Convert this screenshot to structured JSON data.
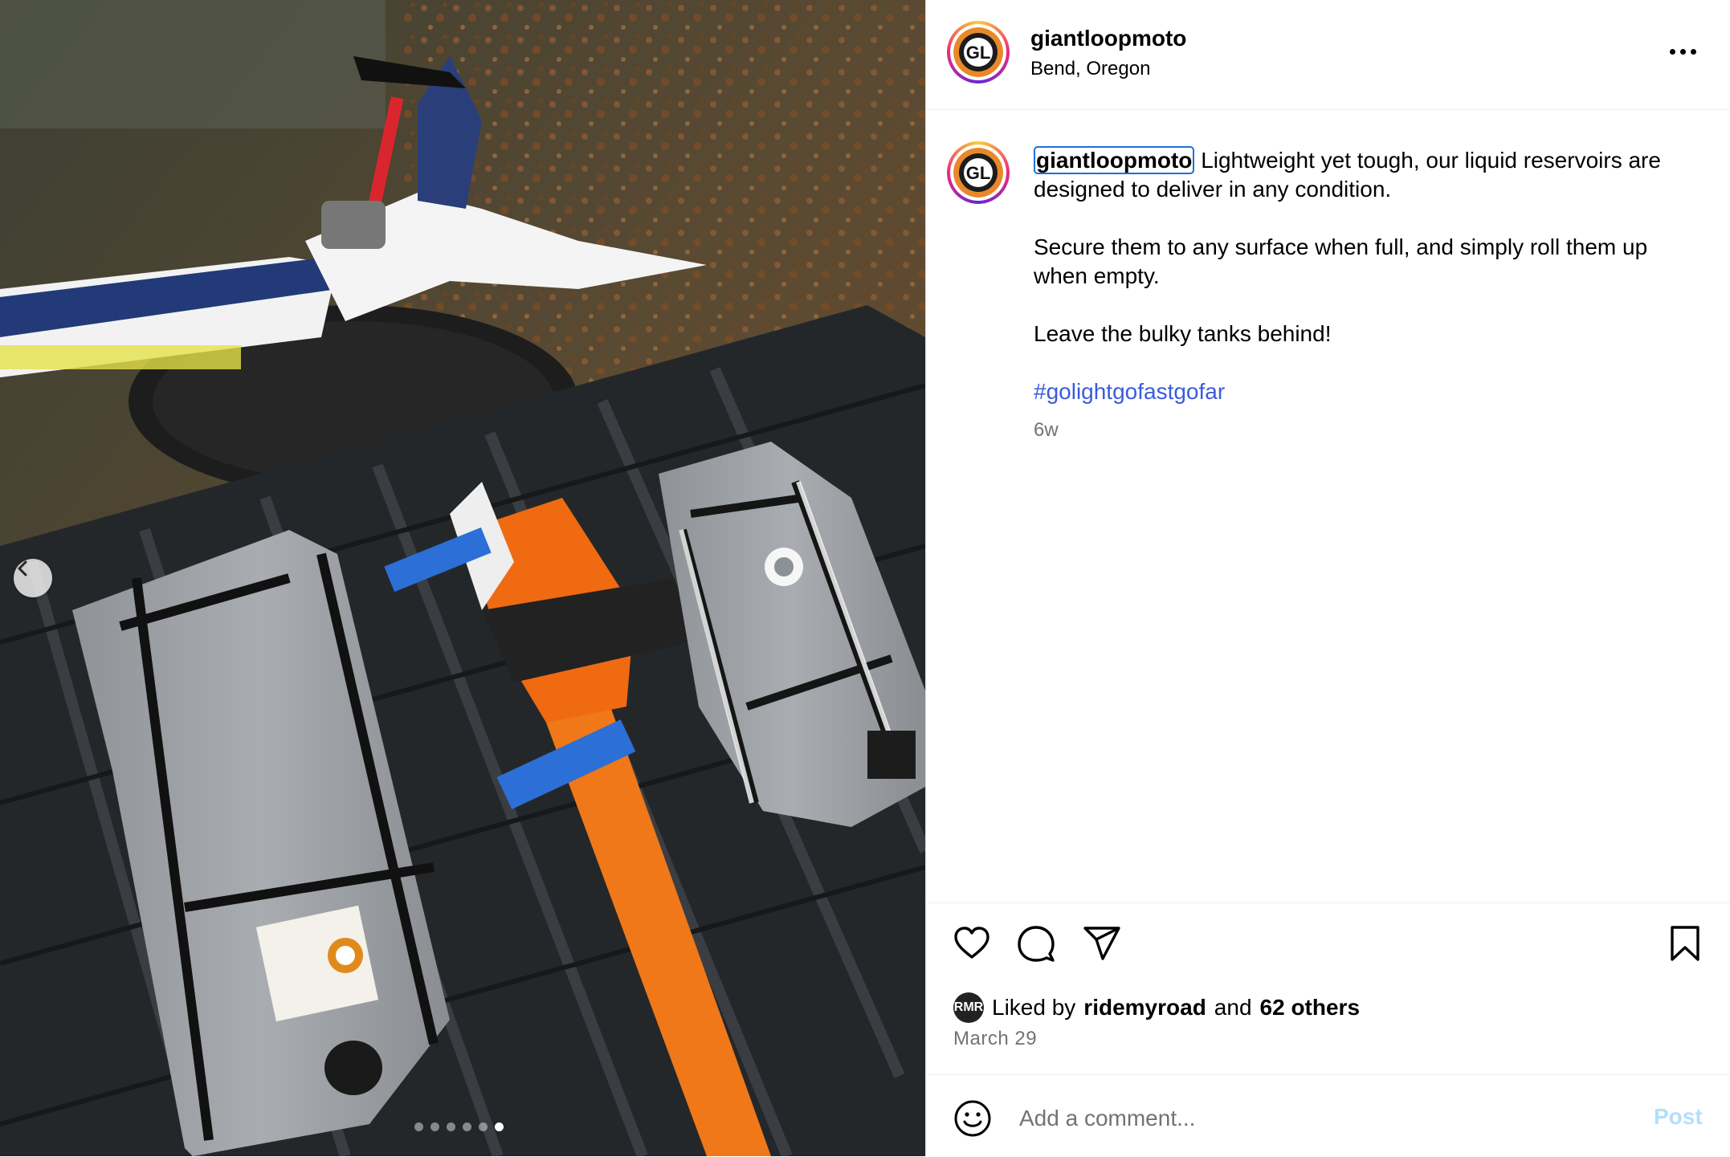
{
  "post": {
    "username": "giantloopmoto",
    "location": "Bend, Oregon",
    "caption": {
      "username": "giantloopmoto",
      "line1": "Lightweight yet tough, our liquid reservoirs are designed to deliver in any condition.",
      "line2": "Secure them to any surface when full, and simply roll them up when empty.",
      "line3": "Leave the bulky tanks behind!",
      "hashtag": "#golightgofastgofar",
      "time_ago": "6w"
    },
    "likes": {
      "liker_username": "ridemyroad",
      "liked_by_label": "Liked by",
      "and_label": "and",
      "others_label": "62 others",
      "liker_initials": "RMR"
    },
    "date": "March 29",
    "comment": {
      "placeholder": "Add a comment...",
      "post_label": "Post"
    }
  },
  "media": {
    "carousel_count": 6,
    "active_index": 5,
    "description_icons": [
      "motorcycle",
      "roof-rack",
      "water-reservoir",
      "chainsaw"
    ]
  },
  "icons": {
    "more": "more-icon",
    "prev": "chevron-left-icon",
    "like": "heart-icon",
    "comment": "comment-icon",
    "share": "share-icon",
    "save": "bookmark-icon",
    "emoji": "emoji-icon"
  },
  "colors": {
    "link": "#3b5bdb",
    "post_disabled": "#b2dffc",
    "muted": "#737373",
    "focus_ring": "#1f6fd6"
  }
}
